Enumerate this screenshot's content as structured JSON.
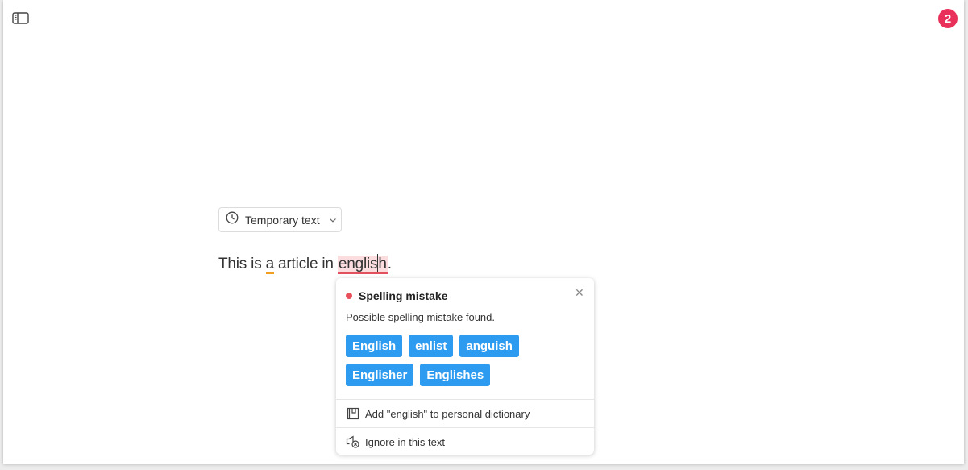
{
  "header": {
    "sidebar_toggle_icon": "sidebar-toggle-icon",
    "notification_count": "2"
  },
  "document_mode": {
    "label": "Temporary text",
    "icon": "clock-icon"
  },
  "editor": {
    "text_before": "This is ",
    "warn_word": "a",
    "text_middle": " article in ",
    "error_word_a": "englis",
    "error_word_b": "h",
    "text_after": "."
  },
  "popup": {
    "title": "Spelling mistake",
    "message": "Possible spelling mistake found.",
    "suggestions": [
      "English",
      "enlist",
      "anguish",
      "Englisher",
      "Englishes"
    ],
    "actions": {
      "add_to_dictionary": "Add \"english\" to personal dictionary",
      "ignore": "Ignore in this text"
    },
    "colors": {
      "dot": "#e8505b",
      "suggestion_bg": "#2d9bf0",
      "error_highlight": "#fbdde0",
      "warning_underline": "#f0a020"
    }
  }
}
